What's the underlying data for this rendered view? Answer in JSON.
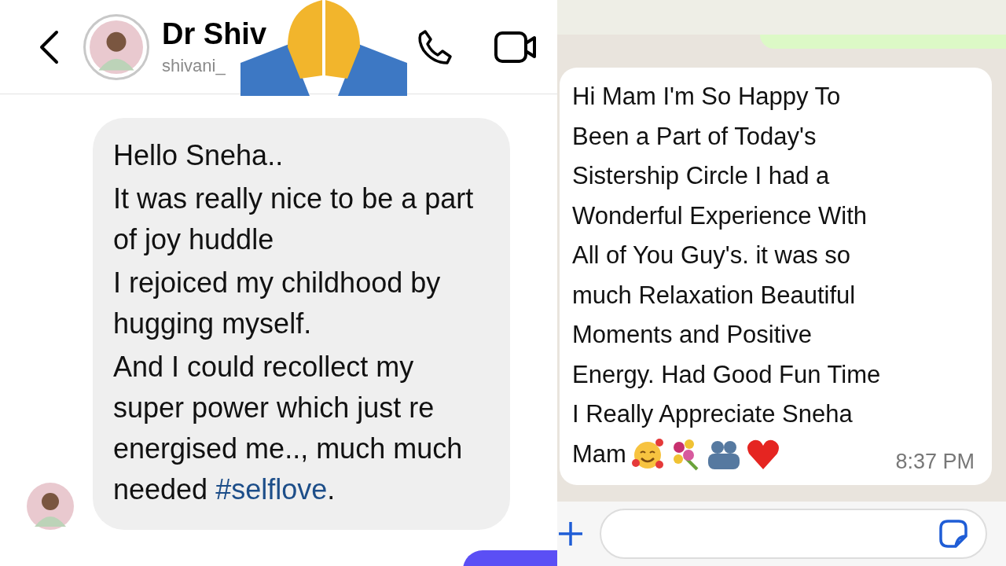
{
  "left_chat": {
    "header": {
      "name": "Dr Shiv",
      "username": "shivani_"
    },
    "message": {
      "paragraphs": [
        "Hello Sneha..",
        "It was really nice to be a part of joy huddle",
        "I rejoiced my childhood by hugging myself."
      ],
      "last_paragraph": {
        "text": "And I could recollect my super power which just re energised me.., much much needed",
        "hashtag": "#selflove",
        "end": "."
      }
    }
  },
  "right_chat": {
    "message": {
      "lines": [
        "Hi Mam I'm So Happy To",
        "Been a Part of Today's",
        "Sistership Circle I had a",
        "Wonderful Experience With",
        "All of You Guy's. it was so",
        "much Relaxation Beautiful",
        "Moments and Positive",
        "Energy. Had Good Fun Time",
        "I Really Appreciate Sneha",
        "Mam"
      ],
      "time": "8:37 PM"
    }
  }
}
